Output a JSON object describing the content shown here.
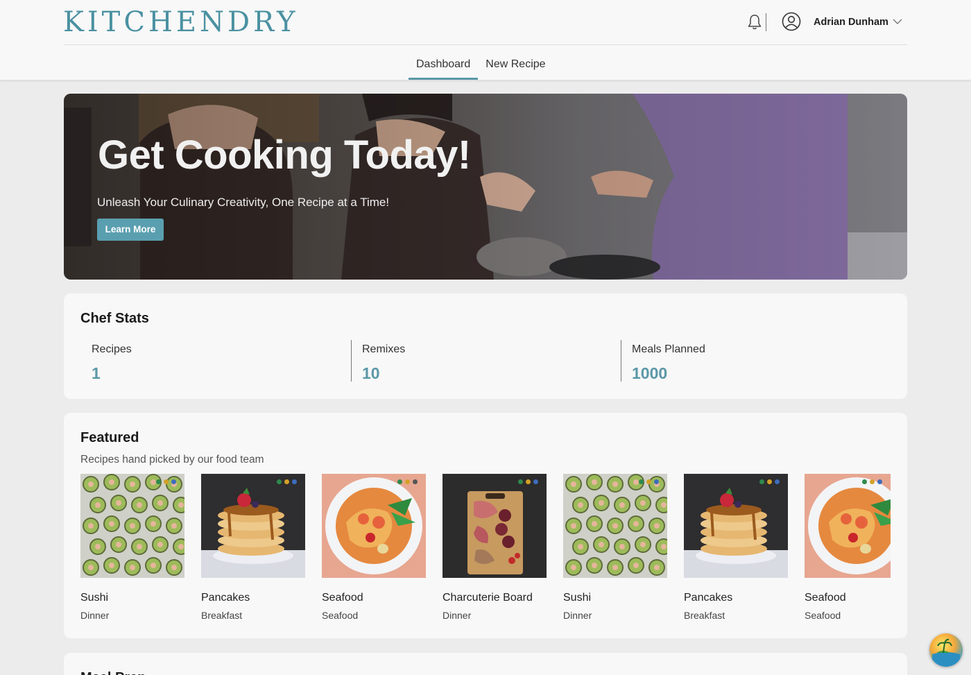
{
  "app": {
    "logo": "KITCHENDRY"
  },
  "header": {
    "icons": {
      "notifications": "bell-icon",
      "account": "user-circle-icon",
      "menu": "chevron-down-icon"
    },
    "user_name": "Adrian Dunham",
    "tabs": [
      {
        "label": "Dashboard",
        "active": true
      },
      {
        "label": "New Recipe",
        "active": false
      }
    ]
  },
  "hero": {
    "title": "Get Cooking Today!",
    "subtitle": "Unleash Your Culinary Creativity, One Recipe at a Time!",
    "button_label": "Learn More"
  },
  "stats": {
    "title": "Chef Stats",
    "items": [
      {
        "label": "Recipes",
        "value": "1"
      },
      {
        "label": "Remixes",
        "value": "10"
      },
      {
        "label": "Meals Planned",
        "value": "1000"
      }
    ]
  },
  "featured": {
    "title": "Featured",
    "subtitle": "Recipes hand picked by our food team",
    "recipes": [
      {
        "name": "Sushi",
        "category": "Dinner",
        "image": "sushi"
      },
      {
        "name": "Pancakes",
        "category": "Breakfast",
        "image": "pancakes"
      },
      {
        "name": "Seafood",
        "category": "Seafood",
        "image": "seafood"
      },
      {
        "name": "Charcuterie Board",
        "category": "Dinner",
        "image": "charcuterie"
      },
      {
        "name": "Sushi",
        "category": "Dinner",
        "image": "sushi"
      },
      {
        "name": "Pancakes",
        "category": "Breakfast",
        "image": "pancakes"
      },
      {
        "name": "Seafood",
        "category": "Seafood",
        "image": "seafood"
      }
    ]
  },
  "meal_card": {
    "title": "Meal Prep..."
  },
  "colors": {
    "accent": "#5b98a8",
    "logo": "#4a91a1",
    "button": "#5a9fb0",
    "page_bg": "#ececed",
    "card_bg": "#f8f8f8"
  }
}
